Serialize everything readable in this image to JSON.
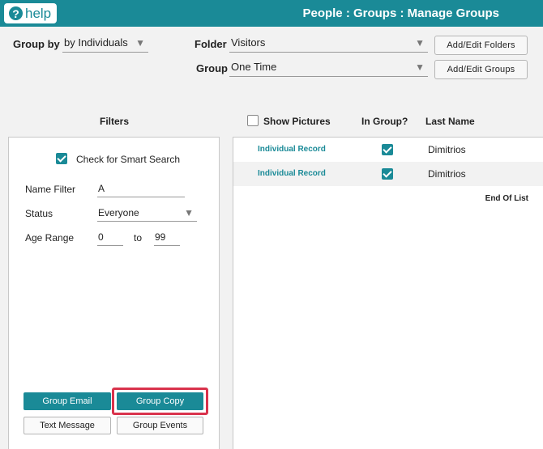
{
  "header": {
    "help_label": "help",
    "help_icon": "question-mark-icon",
    "title": "People : Groups : Manage Groups"
  },
  "controls": {
    "group_by_label": "Group by",
    "group_by_value": "by Individuals",
    "folder_label": "Folder",
    "folder_value": "Visitors",
    "group_label": "Group",
    "group_value": "One Time",
    "add_edit_folders": "Add/Edit Folders",
    "add_edit_groups": "Add/Edit Groups"
  },
  "filters": {
    "title": "Filters",
    "smart_search_label": "Check for Smart Search",
    "smart_search_checked": true,
    "name_filter_label": "Name Filter",
    "name_filter_value": "A",
    "status_label": "Status",
    "status_value": "Everyone",
    "age_range_label": "Age Range",
    "age_from": "0",
    "age_to_label": "to",
    "age_to": "99",
    "buttons": {
      "group_email": "Group Email",
      "group_copy": "Group Copy",
      "text_message": "Text Message",
      "group_events": "Group Events"
    }
  },
  "list": {
    "show_pictures_label": "Show Pictures",
    "show_pictures_checked": false,
    "in_group_header": "In Group?",
    "last_name_header": "Last Name",
    "rows": [
      {
        "link": "Individual Record",
        "in_group": true,
        "last_name": "Dimitrios"
      },
      {
        "link": "Individual Record",
        "in_group": true,
        "last_name": "Dimitrios"
      }
    ],
    "end_text": "End Of List"
  },
  "colors": {
    "accent": "#1a8a97",
    "highlight": "#d9334c",
    "background": "#f2f2f2"
  }
}
